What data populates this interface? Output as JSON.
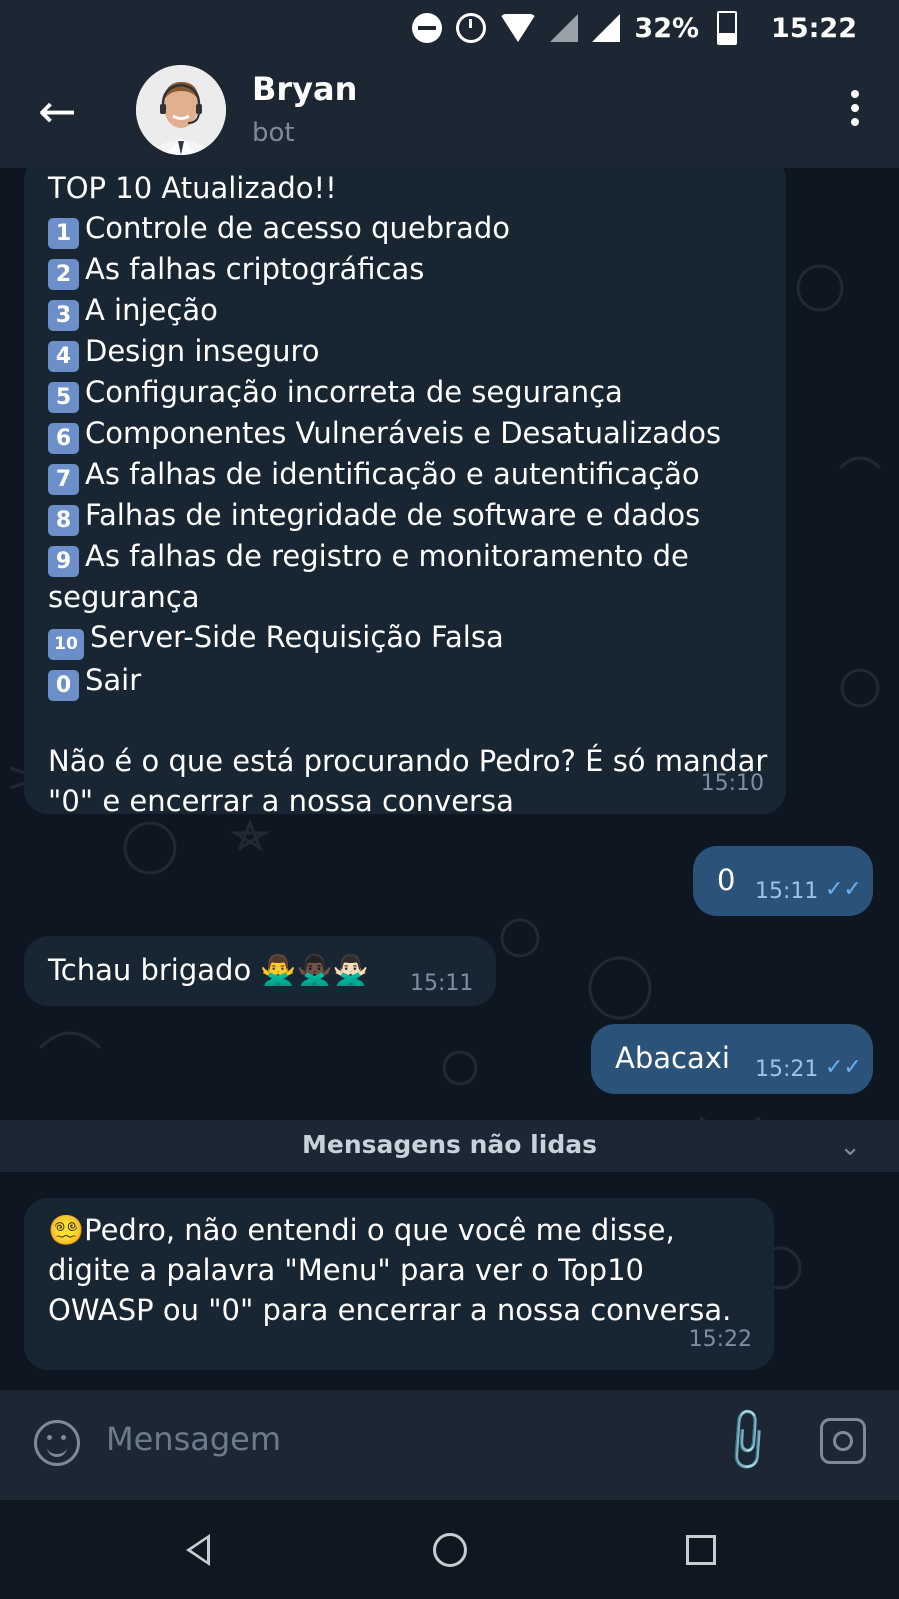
{
  "status": {
    "battery": "32%",
    "time": "15:22"
  },
  "header": {
    "title": "Bryan",
    "subtitle": "bot"
  },
  "messages": {
    "m1": {
      "heading": "TOP 10 Atualizado!!",
      "items": [
        {
          "num": "1",
          "text": "Controle de acesso quebrado"
        },
        {
          "num": "2",
          "text": "As falhas criptográficas"
        },
        {
          "num": "3",
          "text": "A injeção"
        },
        {
          "num": "4",
          "text": "Design inseguro"
        },
        {
          "num": "5",
          "text": "Configuração incorreta de segurança"
        },
        {
          "num": "6",
          "text": "Componentes Vulneráveis e Desatualizados"
        },
        {
          "num": "7",
          "text": "As falhas de identificação e autentificação"
        },
        {
          "num": "8",
          "text": "Falhas de integridade de software e dados"
        },
        {
          "num": "9",
          "text": "As falhas de registro e monitoramento de segurança"
        },
        {
          "num": "10",
          "text": "Server-Side Requisição Falsa"
        },
        {
          "num": "0",
          "text": "Sair"
        }
      ],
      "footer": "Não é o que está procurando Pedro? É só mandar \"0\" e encerrar a nossa conversa",
      "time": "15:10"
    },
    "m2": {
      "text": "0",
      "time": "15:11"
    },
    "m3": {
      "text": "Tchau brigado 🙅‍♂️🙅🏿‍♂️🙅🏻‍♂️",
      "time": "15:11"
    },
    "m4": {
      "text": "Abacaxi",
      "time": "15:21"
    },
    "m5": {
      "text": "😵‍💫Pedro, não entendi o que você me disse, digite a palavra \"Menu\" para ver o Top10 OWASP ou \"0\" para encerrar a nossa conversa.",
      "time": "15:22"
    }
  },
  "unread_label": "Mensagens não lidas",
  "composer": {
    "placeholder": "Mensagem"
  }
}
